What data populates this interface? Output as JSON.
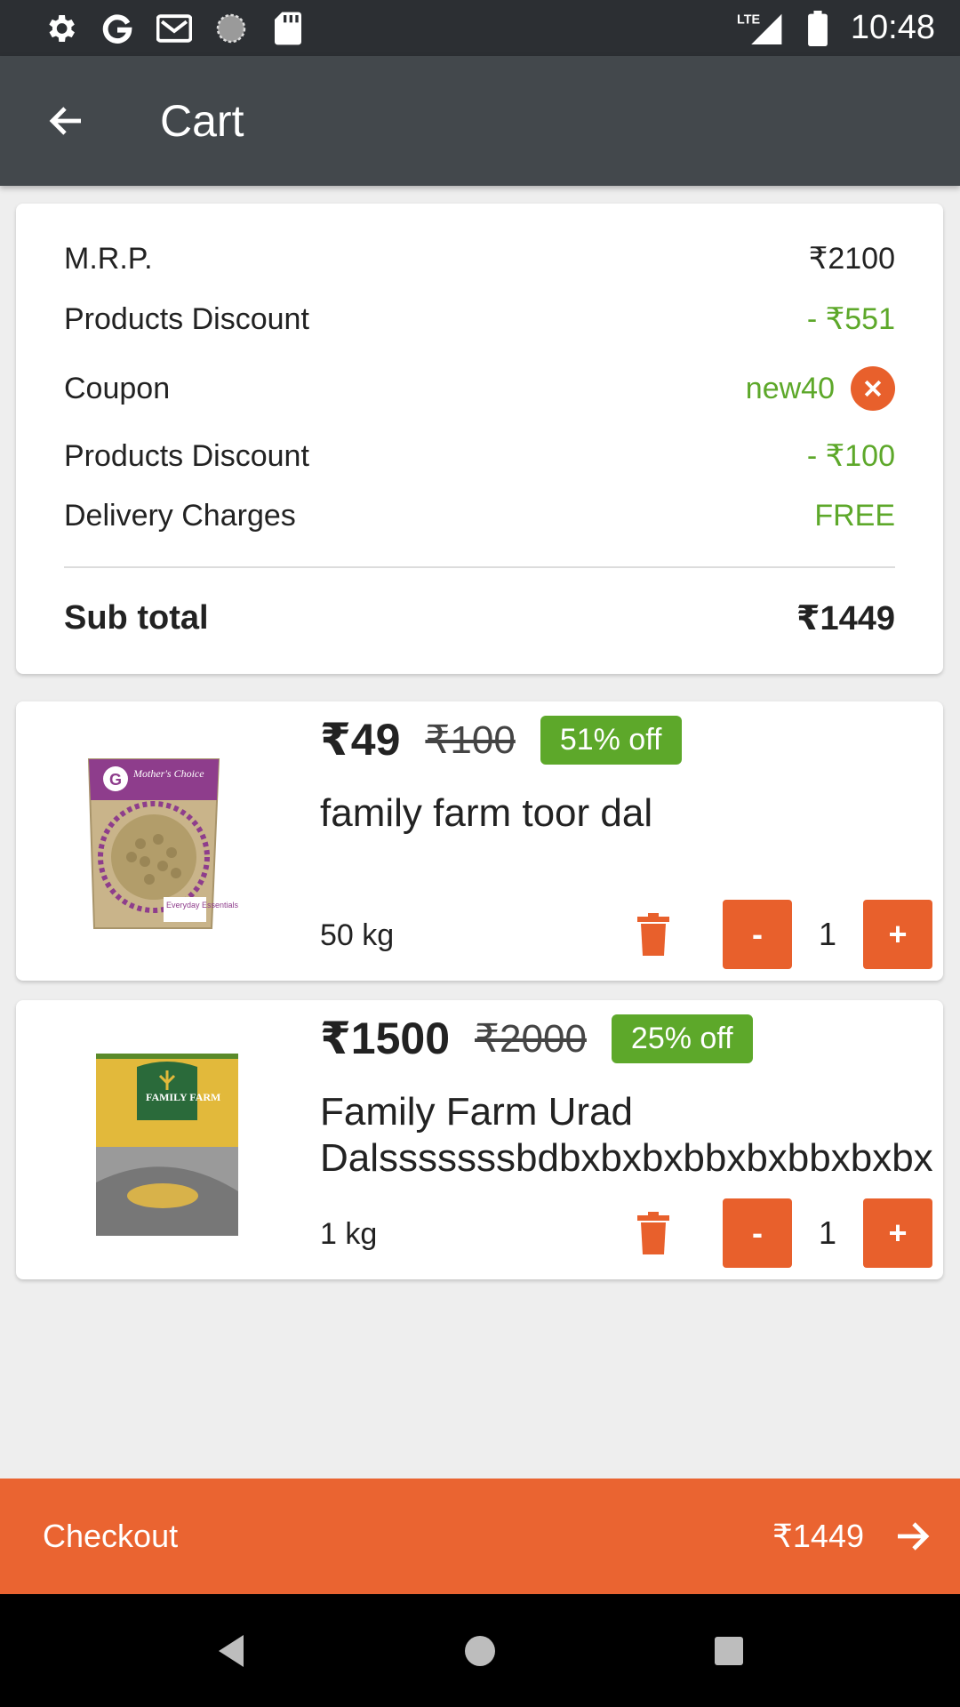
{
  "status_bar": {
    "time": "10:48",
    "network": "LTE",
    "icons": [
      "gear-icon",
      "google-icon",
      "gmail-icon",
      "sync-icon",
      "sd-card-icon",
      "signal-icon",
      "battery-icon"
    ]
  },
  "app_bar": {
    "title": "Cart",
    "back_icon": "arrow-left-icon"
  },
  "summary": {
    "mrp_label": "M.R.P.",
    "mrp_value": "₹2100",
    "products_discount_label": "Products Discount",
    "products_discount_value": "- ₹551",
    "coupon_label": "Coupon",
    "coupon_code": "new40",
    "coupon_discount_label": "Products Discount",
    "coupon_discount_value": "- ₹100",
    "delivery_label": "Delivery Charges",
    "delivery_value": "FREE",
    "subtotal_label": "Sub total",
    "subtotal_value": "₹1449"
  },
  "items": [
    {
      "price": "₹49",
      "mrp": "₹100",
      "discount": "51% off",
      "name": "family farm toor dal",
      "weight": "50 kg",
      "quantity": "1",
      "minus": "-",
      "plus": "+",
      "brand_text": "Mother's Choice",
      "pack_text": "Everyday Essentials"
    },
    {
      "price": "₹1500",
      "mrp": "₹2000",
      "discount": "25% off",
      "name": "Family Farm Urad Dalsssssssbdbxbxbxbbxbxbbxbxbxbxbbxb",
      "weight": "1 kg",
      "quantity": "1",
      "minus": "-",
      "plus": "+",
      "brand_text": "FAMILY FARM"
    }
  ],
  "checkout": {
    "label": "Checkout",
    "amount": "₹1449"
  },
  "colors": {
    "accent": "#e8602c",
    "green": "#5da82a",
    "app_bar": "#43484c",
    "status_bar": "#2c2f33"
  }
}
